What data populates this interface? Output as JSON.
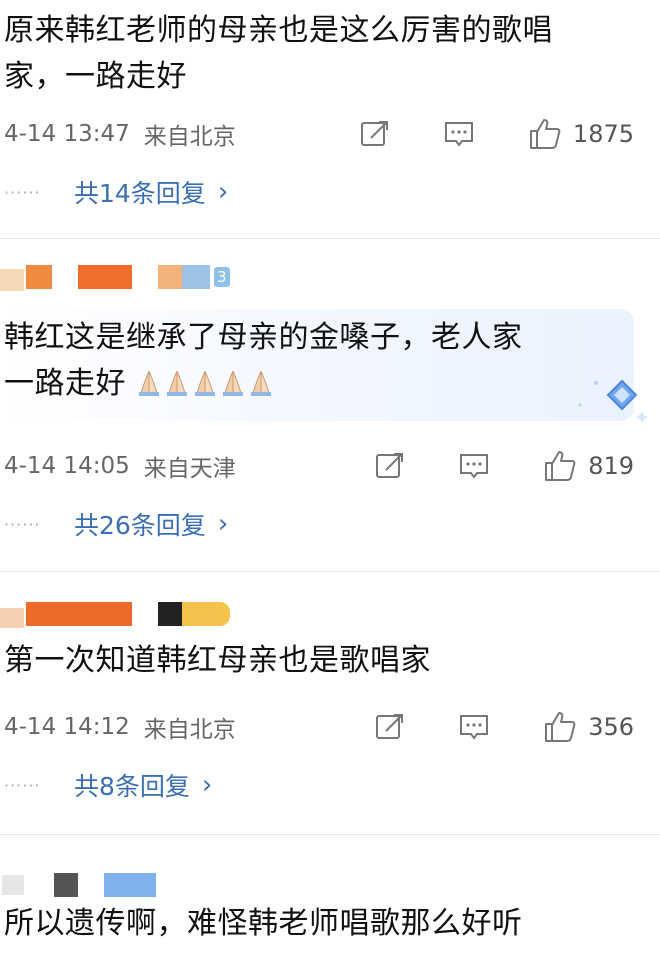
{
  "comments": [
    {
      "text_line1": "原来韩红老师的母亲也是这么厉害的歌唱",
      "text_line2": "家，一路走好",
      "time": "4-14 13:47",
      "location": "来自北京",
      "likes": "1875",
      "replies": "共14条回复"
    },
    {
      "text_line1": "韩红这是继承了母亲的金嗓子，老人家",
      "text_line2": "一路走好",
      "emoji_names": [
        "folded-hands-icon",
        "folded-hands-icon",
        "folded-hands-icon",
        "folded-hands-icon",
        "folded-hands-icon"
      ],
      "badge": "3",
      "time": "4-14 14:05",
      "location": "来自天津",
      "likes": "819",
      "replies": "共26条回复"
    },
    {
      "text_line1": "第一次知道韩红母亲也是歌唱家",
      "time": "4-14 14:12",
      "location": "来自北京",
      "likes": "356",
      "replies": "共8条回复"
    },
    {
      "text_line1": "所以遗传啊，难怪韩老师唱歌那么好听"
    }
  ],
  "icons": {
    "repost": "repost-icon",
    "comment": "comment-icon",
    "like": "thumbs-up-icon",
    "chevron": "chevron-right-icon",
    "ellipsis": "······"
  },
  "colors": {
    "link": "#3b6fb3",
    "meta": "#666666",
    "divider": "#e8e8e8",
    "highlight": "#e9f2ff"
  }
}
